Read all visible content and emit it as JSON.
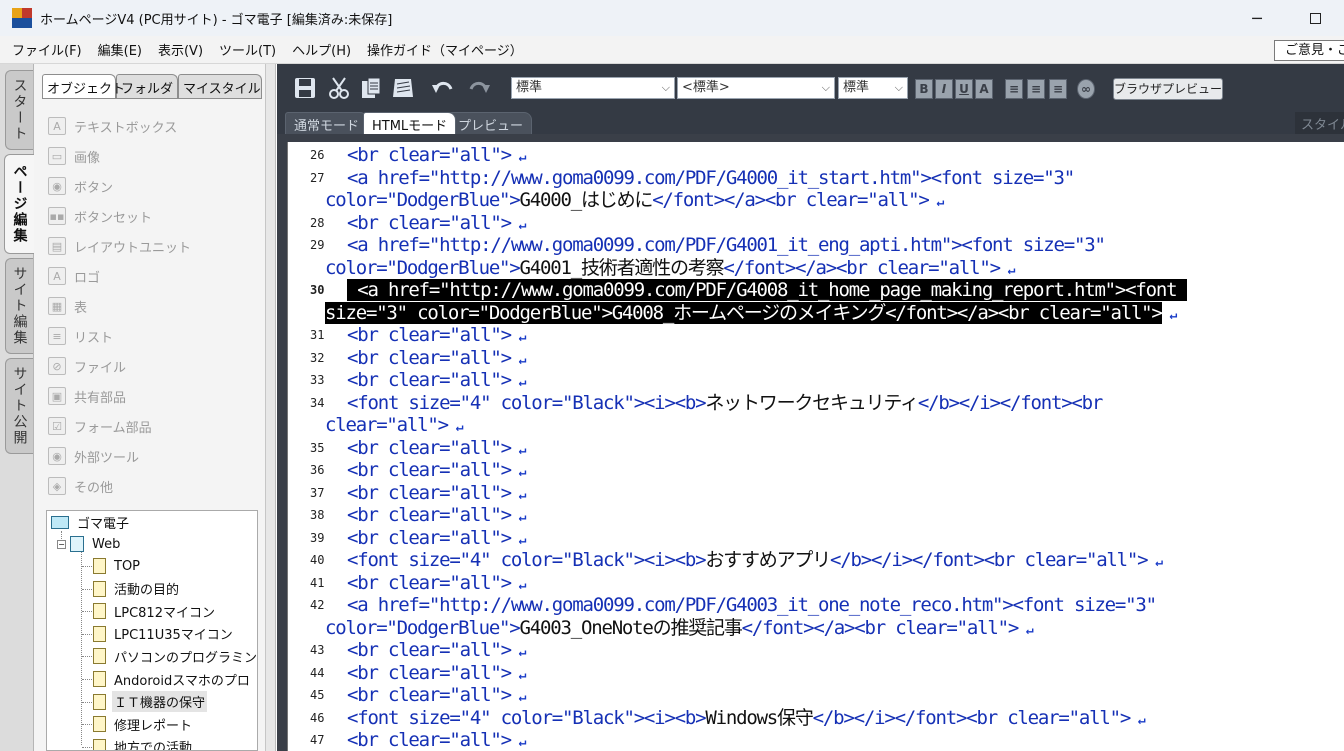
{
  "window": {
    "title": "ホームページV4 (PC用サイト) - ゴマ電子 [編集済み:未保存]",
    "minimize": "─"
  },
  "menu": [
    "ファイル(F)",
    "編集(E)",
    "表示(V)",
    "ツール(T)",
    "ヘルプ(H)",
    "操作ガイド（マイページ）"
  ],
  "feedback_label": "ご意見・ご",
  "vtabs": [
    "スタート",
    "ページ編集",
    "サイト編集",
    "サイト公開"
  ],
  "active_vtab": "ページ編集",
  "object_tabs": [
    "オブジェクト",
    "フォルダ",
    "マイスタイル"
  ],
  "objects": [
    {
      "label": "テキストボックス",
      "icon": "text-box-icon",
      "glyph": "A"
    },
    {
      "label": "画像",
      "icon": "image-icon",
      "glyph": "▭"
    },
    {
      "label": "ボタン",
      "icon": "button-icon",
      "glyph": "◉"
    },
    {
      "label": "ボタンセット",
      "icon": "button-set-icon",
      "glyph": "▪▪"
    },
    {
      "label": "レイアウトユニット",
      "icon": "layout-unit-icon",
      "glyph": "▤"
    },
    {
      "label": "ロゴ",
      "icon": "logo-icon",
      "glyph": "A"
    },
    {
      "label": "表",
      "icon": "table-icon",
      "glyph": "▦"
    },
    {
      "label": "リスト",
      "icon": "list-icon",
      "glyph": "≡"
    },
    {
      "label": "ファイル",
      "icon": "file-icon",
      "glyph": "⊘"
    },
    {
      "label": "共有部品",
      "icon": "shared-parts-icon",
      "glyph": "▣"
    },
    {
      "label": "フォーム部品",
      "icon": "form-parts-icon",
      "glyph": "☑"
    },
    {
      "label": "外部ツール",
      "icon": "external-tool-icon",
      "glyph": "◉"
    },
    {
      "label": "その他",
      "icon": "other-icon",
      "glyph": "◈"
    }
  ],
  "tree": {
    "root": "ゴマ電子",
    "web": "Web",
    "pages": [
      "TOP",
      "活動の目的",
      "LPC812マイコン",
      "LPC11U35マイコン",
      "パソコンのプログラミング",
      "Andoroidスマホのプロ",
      "ＩＴ機器の保守",
      "修理レポート",
      "地方での活動"
    ],
    "selected": "ＩＴ機器の保守"
  },
  "toolbar": {
    "style_select": "標準",
    "paragraph_select": "<標準>",
    "size_select": "標準",
    "bold": "B",
    "italic": "I",
    "underline": "U",
    "color": "A",
    "preview_button": "ブラウザプレビュー"
  },
  "mode_tabs": [
    "通常モード",
    "HTMLモード",
    "プレビュー"
  ],
  "active_mode": "HTMLモード",
  "style_panel_label": "スタイル",
  "code_lines": [
    {
      "n": "26",
      "t": "<br clear=\"all\">"
    },
    {
      "n": "27",
      "t": "<a href=\"http://www.goma0099.com/PDF/G4000_it_start.htm\"><font size=\"3\""
    },
    {
      "n": "",
      "t": "color=\"DodgerBlue\">",
      "x": "G4000_はじめに",
      "e": "</font></a><br clear=\"all\">"
    },
    {
      "n": "28",
      "t": "<br clear=\"all\">"
    },
    {
      "n": "29",
      "t": "<a href=\"http://www.goma0099.com/PDF/G4001_it_eng_apti.htm\"><font size=\"3\""
    },
    {
      "n": "",
      "t": "color=\"DodgerBlue\">",
      "x": "G4001_技術者適性の考察",
      "e": "</font></a><br clear=\"all\">"
    },
    {
      "n": "30",
      "t": " <a href=\"http://www.goma0099.com/PDF/G4008_it_home_page_making_report.htm\"><font "
    },
    {
      "n": "",
      "t": "size=\"3\" color=\"DodgerBlue\">G4008_ホームページのメイキング</font></a><br clear=\"all\">"
    },
    {
      "n": "31",
      "t": "<br clear=\"all\">"
    },
    {
      "n": "32",
      "t": "<br clear=\"all\">"
    },
    {
      "n": "33",
      "t": "<br clear=\"all\">"
    },
    {
      "n": "34",
      "t": "<font size=\"4\" color=\"Black\"><i><b>",
      "x": "ネットワークセキュリティ",
      "e": "</b></i></font><br"
    },
    {
      "n": "",
      "t": "clear=\"all\">"
    },
    {
      "n": "35",
      "t": "<br clear=\"all\">"
    },
    {
      "n": "36",
      "t": "<br clear=\"all\">"
    },
    {
      "n": "37",
      "t": "<br clear=\"all\">"
    },
    {
      "n": "38",
      "t": "<br clear=\"all\">"
    },
    {
      "n": "39",
      "t": "<br clear=\"all\">"
    },
    {
      "n": "40",
      "t": "<font size=\"4\" color=\"Black\"><i><b>",
      "x": "おすすめアプリ",
      "e": "</b></i></font><br clear=\"all\">"
    },
    {
      "n": "41",
      "t": "<br clear=\"all\">"
    },
    {
      "n": "42",
      "t": "<a href=\"http://www.goma0099.com/PDF/G4003_it_one_note_reco.htm\"><font size=\"3\""
    },
    {
      "n": "",
      "t": "color=\"DodgerBlue\">",
      "x": "G4003_OneNoteの推奨記事",
      "e": "</font></a><br clear=\"all\">"
    },
    {
      "n": "43",
      "t": "<br clear=\"all\">"
    },
    {
      "n": "44",
      "t": "<br clear=\"all\">"
    },
    {
      "n": "45",
      "t": "<br clear=\"all\">"
    },
    {
      "n": "46",
      "t": "<font size=\"4\" color=\"Black\"><i><b>",
      "x": "Windows保守",
      "e": "</b></i></font><br clear=\"all\">"
    },
    {
      "n": "47",
      "t": "<br clear=\"all\">"
    }
  ],
  "highlighted_line": "30",
  "colors": {
    "code_tag": "#1530b5",
    "code_text": "#111111",
    "editor_bg": "#343a44",
    "highlight_bg": "#000000"
  }
}
